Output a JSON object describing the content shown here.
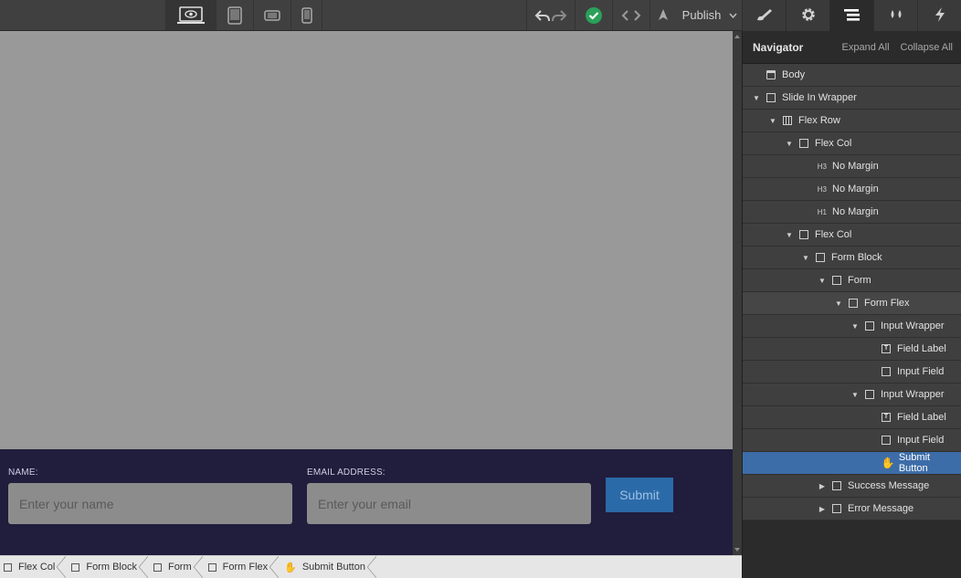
{
  "toolbar": {
    "publish_label": "Publish",
    "colors": {
      "success": "#2aa05a"
    }
  },
  "canvas": {
    "form": {
      "name_label": "NAME:",
      "name_placeholder": "Enter your name",
      "email_label": "EMAIL ADDRESS:",
      "email_placeholder": "Enter your email",
      "submit_label": "Submit"
    },
    "colors": {
      "page_bg": "#999999",
      "form_bg": "#201d3d",
      "submit_bg": "#2b6aa8"
    }
  },
  "breadcrumb": [
    {
      "label": "Flex Col",
      "icon": "box-icon"
    },
    {
      "label": "Form Block",
      "icon": "box-icon"
    },
    {
      "label": "Form",
      "icon": "box-icon"
    },
    {
      "label": "Form Flex",
      "icon": "box-icon"
    },
    {
      "label": "Submit Button",
      "icon": "hand-icon"
    }
  ],
  "navigator": {
    "title": "Navigator",
    "expand_all": "Expand All",
    "collapse_all": "Collapse All",
    "items": [
      {
        "label": "Body",
        "depth": 0,
        "arrow": "",
        "icon": "body"
      },
      {
        "label": "Slide In Wrapper",
        "depth": 0,
        "arrow": "down",
        "icon": "box"
      },
      {
        "label": "Flex Row",
        "depth": 1,
        "arrow": "down",
        "icon": "flexrow"
      },
      {
        "label": "Flex Col",
        "depth": 2,
        "arrow": "down",
        "icon": "box"
      },
      {
        "label": "No Margin",
        "depth": 3,
        "arrow": "",
        "icon": "tag",
        "tag": "H3"
      },
      {
        "label": "No Margin",
        "depth": 3,
        "arrow": "",
        "icon": "tag",
        "tag": "H3"
      },
      {
        "label": "No Margin",
        "depth": 3,
        "arrow": "",
        "icon": "tag",
        "tag": "H1"
      },
      {
        "label": "Flex Col",
        "depth": 2,
        "arrow": "down",
        "icon": "box"
      },
      {
        "label": "Form Block",
        "depth": 3,
        "arrow": "down",
        "icon": "box"
      },
      {
        "label": "Form",
        "depth": 4,
        "arrow": "down",
        "icon": "box"
      },
      {
        "label": "Form Flex",
        "depth": 5,
        "arrow": "down",
        "icon": "box",
        "dim": true
      },
      {
        "label": "Input Wrapper",
        "depth": 6,
        "arrow": "down",
        "icon": "box"
      },
      {
        "label": "Field Label",
        "depth": 7,
        "arrow": "",
        "icon": "text"
      },
      {
        "label": "Input Field",
        "depth": 7,
        "arrow": "",
        "icon": "box"
      },
      {
        "label": "Input Wrapper",
        "depth": 6,
        "arrow": "down",
        "icon": "box"
      },
      {
        "label": "Field Label",
        "depth": 7,
        "arrow": "",
        "icon": "text"
      },
      {
        "label": "Input Field",
        "depth": 7,
        "arrow": "",
        "icon": "box"
      },
      {
        "label": "Submit Button",
        "depth": 7,
        "arrow": "",
        "icon": "hand",
        "selected": true
      },
      {
        "label": "Success Message",
        "depth": 4,
        "arrow": "right",
        "icon": "box"
      },
      {
        "label": "Error Message",
        "depth": 4,
        "arrow": "right",
        "icon": "box"
      }
    ]
  },
  "panel_tabs": [
    {
      "icon": "brush-icon"
    },
    {
      "icon": "gear-icon"
    },
    {
      "icon": "navigator-icon",
      "active": true
    },
    {
      "icon": "drops-icon"
    },
    {
      "icon": "lightning-icon"
    }
  ]
}
